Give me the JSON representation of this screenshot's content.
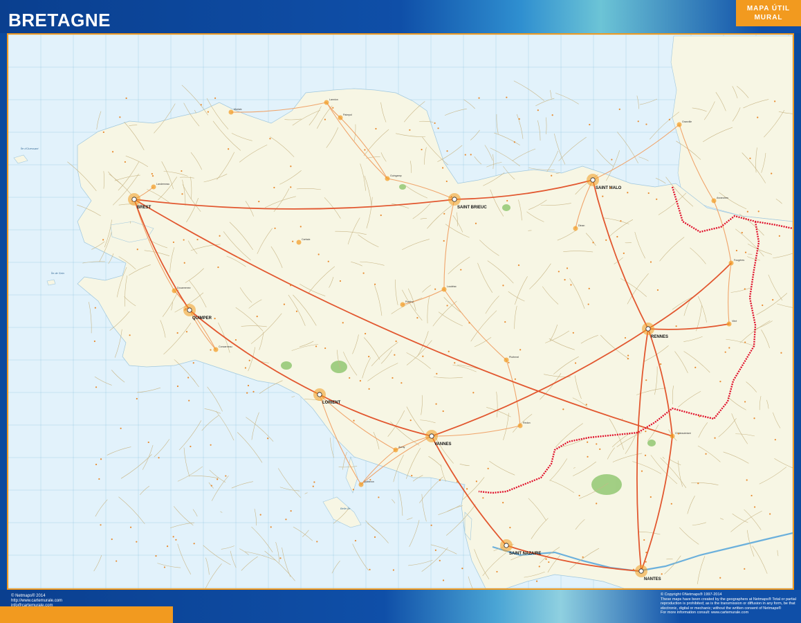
{
  "header": {
    "title": "BRETAGNE",
    "badge_line1": "MAPA ÚTIL",
    "badge_line2": "MURAL"
  },
  "map": {
    "colors": {
      "sea": "#e2f2fb",
      "land": "#f7f6e4",
      "grid": "#8ec2e0",
      "major_road": "#e2572f",
      "secondary_road": "#f0a46a",
      "minor_road": "#c9b788",
      "border": "#e0112b",
      "city": "#f29a1f",
      "forest": "#8cc56c",
      "river": "#6bb0dc"
    },
    "cities": [
      {
        "name": "BREST"
      },
      {
        "name": "QUIMPER"
      },
      {
        "name": "LORIENT"
      },
      {
        "name": "VANNES"
      },
      {
        "name": "SAINT BRIEUC"
      },
      {
        "name": "SAINT MALO"
      },
      {
        "name": "RENNES"
      },
      {
        "name": "SAINT NAZAIRE"
      },
      {
        "name": "NANTES"
      }
    ],
    "towns": [
      {
        "name": "Morlaix"
      },
      {
        "name": "Lannion"
      },
      {
        "name": "Guingamp"
      },
      {
        "name": "Dinan"
      },
      {
        "name": "Fougères"
      },
      {
        "name": "Vitré"
      },
      {
        "name": "Pontivy"
      },
      {
        "name": "Loudéac"
      },
      {
        "name": "Carhaix"
      },
      {
        "name": "Redon"
      },
      {
        "name": "Ploërmel"
      },
      {
        "name": "Concarneau"
      },
      {
        "name": "Douarnenez"
      },
      {
        "name": "Auray"
      },
      {
        "name": "Quiberon"
      },
      {
        "name": "Châteaubriant"
      },
      {
        "name": "Granville"
      },
      {
        "name": "Avranches"
      },
      {
        "name": "Landerneau"
      },
      {
        "name": "Paimpol"
      }
    ],
    "islands": [
      {
        "name": "Belle-Île"
      },
      {
        "name": "Île d'Ouessant"
      },
      {
        "name": "Île de Sein"
      }
    ]
  },
  "footer": {
    "left_line1": "© Netmaps® 2014",
    "left_line2": "http://www.cartemurale.com",
    "left_line3": "info@cartemurale.com",
    "right_line1": "© Copyright ©Netmaps® 1997-2014",
    "right_line2": "These maps have been created by the geographers at Netmaps® Total or partial",
    "right_line3": "reproduction is prohibited; as is the transmission or diffusion in any form, be that",
    "right_line4": "electronic, digital or mechanic; without the written consent of Netmaps®",
    "right_line5": "For more information consult: www.cartemurale.com"
  }
}
